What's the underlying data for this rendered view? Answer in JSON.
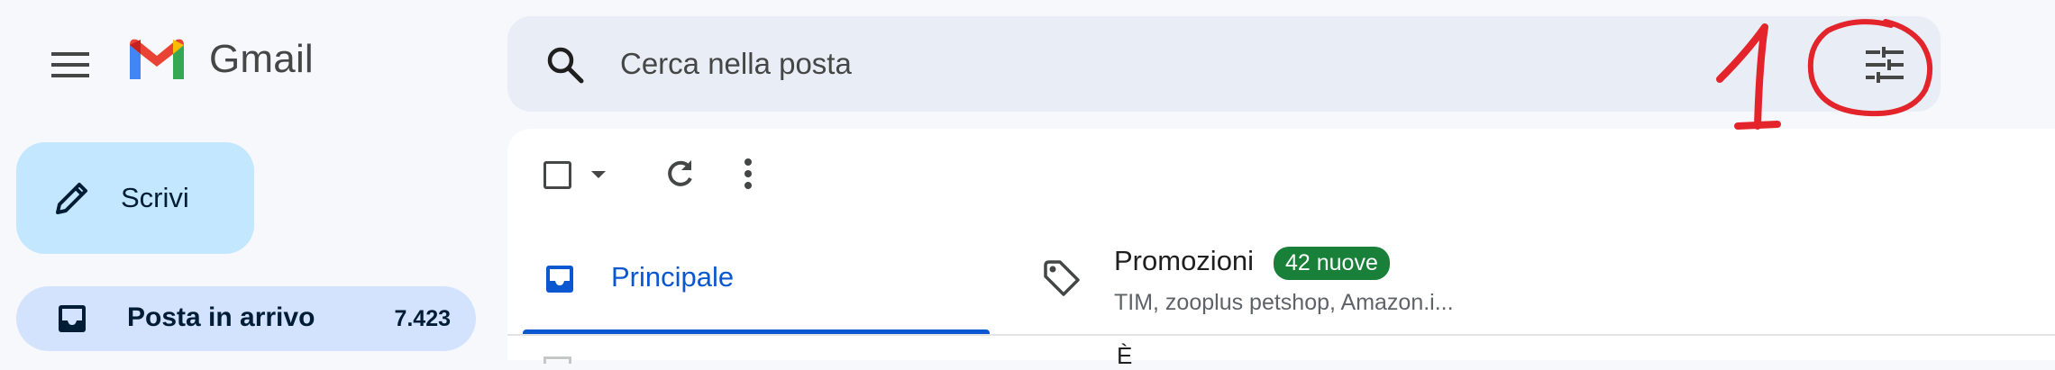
{
  "app": {
    "name": "Gmail"
  },
  "brand_colors": {
    "m_blue": "#4285f4",
    "m_red": "#ea4335",
    "m_yellow": "#fbbc04",
    "m_green": "#34a853"
  },
  "header": {
    "menu_icon": "hamburger-menu-icon",
    "search": {
      "placeholder": "Cerca nella posta",
      "icon": "search-icon"
    },
    "filter_icon": "tune-icon"
  },
  "sidebar": {
    "compose_label": "Scrivi",
    "compose_icon": "pencil-icon",
    "items": [
      {
        "label": "Posta in arrivo",
        "count": "7.423",
        "icon": "inbox-icon",
        "active": true
      }
    ]
  },
  "toolbar": {
    "select_icon": "checkbox-icon",
    "select_menu_icon": "caret-down-icon",
    "refresh_icon": "refresh-icon",
    "more_icon": "more-vert-icon"
  },
  "tabs": [
    {
      "label": "Principale",
      "icon": "inbox-icon",
      "active": true,
      "color": "#0b57d0"
    },
    {
      "label": "Promozioni",
      "badge": "42 nuove",
      "snippet": "TIM, zooplus petshop, Amazon.i...",
      "icon": "tag-icon",
      "badge_color": "#188038"
    }
  ],
  "email_rows_partial": [
    {
      "char": "È"
    }
  ],
  "annotation": {
    "number": "1",
    "color": "#e3242b"
  }
}
